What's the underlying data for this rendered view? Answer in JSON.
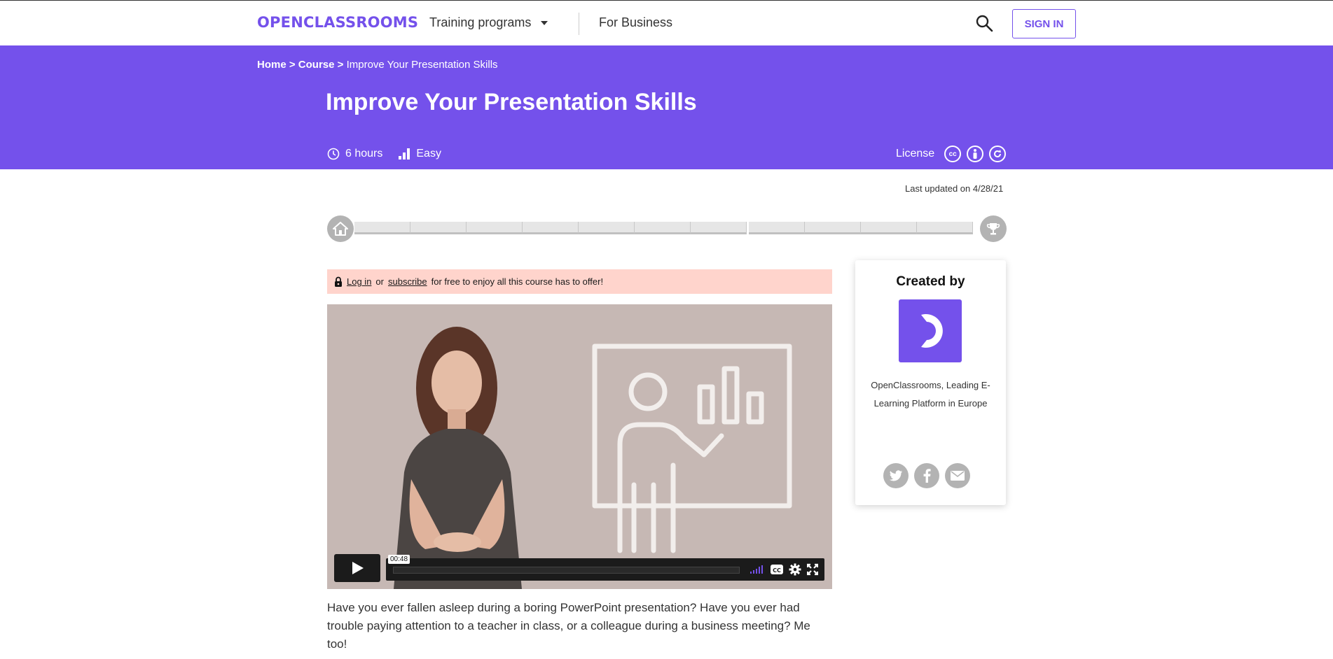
{
  "nav": {
    "logo": "OPENCLASSROOMS",
    "training_label": "Training programs",
    "business_label": "For Business",
    "signin_label": "SIGN IN"
  },
  "breadcrumb": {
    "home": "Home",
    "sep": ">",
    "course": "Course",
    "current": "Improve Your Presentation Skills"
  },
  "course": {
    "title": "Improve Your Presentation Skills",
    "duration": "6 hours",
    "difficulty": "Easy",
    "license_label": "License",
    "last_updated": "Last updated on 4/28/21"
  },
  "alert": {
    "login": "Log in",
    "or": "or",
    "subscribe": "subscribe",
    "rest": "for free to enjoy all this course has to offer!"
  },
  "video": {
    "time": "00:48",
    "volume_level": 1.0
  },
  "intro_text": "Have you ever fallen asleep during a boring PowerPoint presentation? Have you ever had trouble paying attention to a teacher in class, or a colleague during a business meeting? Me too!",
  "creator": {
    "title": "Created by",
    "description": "OpenClassrooms, Leading E-Learning Platform in Europe"
  },
  "colors": {
    "brand": "#7451eb",
    "alert_bg": "#ffd4cc"
  },
  "icons": [
    "search-icon",
    "caret-down-icon",
    "clock-icon",
    "difficulty-bars-icon",
    "cc-icon",
    "by-icon",
    "sa-icon",
    "home-icon",
    "trophy-icon",
    "lock-icon",
    "play-icon",
    "volume-icon",
    "captions-icon",
    "settings-icon",
    "fullscreen-icon",
    "twitter-icon",
    "facebook-icon",
    "email-icon"
  ]
}
